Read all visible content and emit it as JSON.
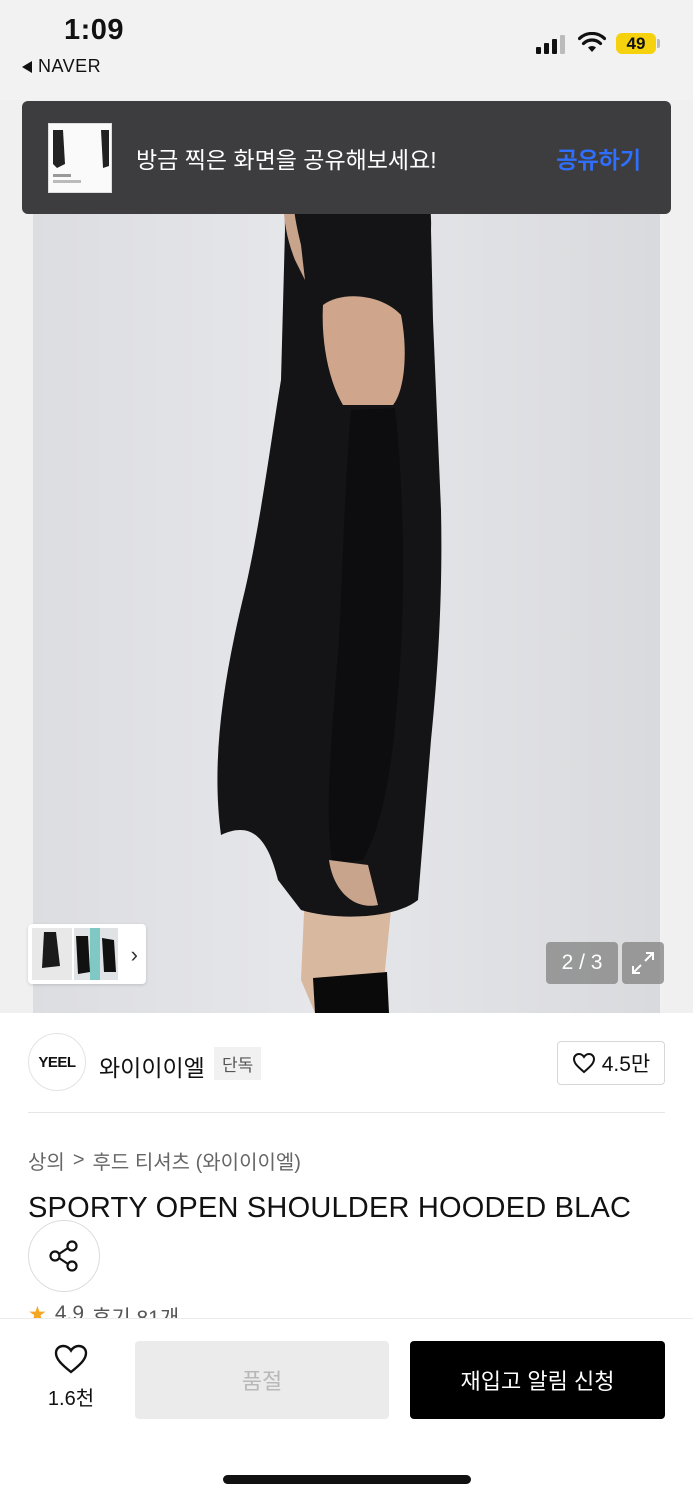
{
  "status_bar": {
    "time": "1:09",
    "back_app": "NAVER",
    "battery": "49",
    "battery_color": "#f5d20d"
  },
  "toast": {
    "message": "방금 찍은 화면을 공유해보세요!",
    "action": "공유하기",
    "action_color": "#2f6fff"
  },
  "gallery": {
    "counter": "2 / 3",
    "expand_icon": "expand-icon",
    "thumbnails_chevron": "chevron-right-icon"
  },
  "brand": {
    "logo_text": "YEEL",
    "name": "와이이이엘",
    "badge": "단독",
    "likes": "4.5만"
  },
  "breadcrumb": {
    "category": "상의",
    "separator": ">",
    "subcategory": "후드 티셔츠 (와이이이엘)"
  },
  "product": {
    "title": "SPORTY OPEN SHOULDER HOODED BLAC",
    "rating": "4.9",
    "reviews": "후기 81개"
  },
  "bottom_bar": {
    "wish_count": "1.6천",
    "soldout_label": "품절",
    "restock_label": "재입고 알림 신청"
  }
}
